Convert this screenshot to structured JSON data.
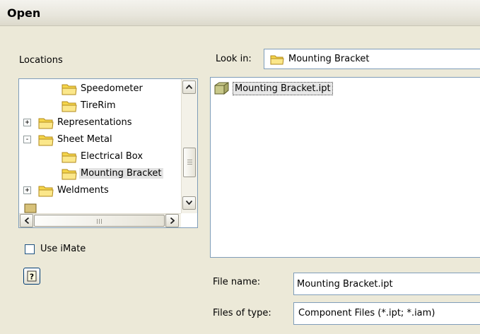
{
  "window": {
    "title": "Open"
  },
  "locations": {
    "label": "Locations",
    "items": [
      {
        "label": "Speedometer",
        "level": 2,
        "expander": "",
        "selected": false
      },
      {
        "label": "TireRim",
        "level": 2,
        "expander": "",
        "selected": false
      },
      {
        "label": "Representations",
        "level": 1,
        "expander": "+",
        "selected": false
      },
      {
        "label": "Sheet Metal",
        "level": 1,
        "expander": "−",
        "selected": false
      },
      {
        "label": "Electrical Box",
        "level": 2,
        "expander": "",
        "selected": false
      },
      {
        "label": "Mounting Bracket",
        "level": 2,
        "expander": "",
        "selected": true
      },
      {
        "label": "Weldments",
        "level": 1,
        "expander": "+",
        "selected": false
      }
    ]
  },
  "look_in": {
    "label": "Look in:",
    "value": "Mounting Bracket"
  },
  "files": [
    {
      "name": "Mounting Bracket.ipt"
    }
  ],
  "use_imate": {
    "label": "Use iMate",
    "checked": false
  },
  "help": {
    "glyph": "?"
  },
  "file_name": {
    "label": "File name:",
    "value": "Mounting Bracket.ipt"
  },
  "file_type": {
    "label": "Files of type:",
    "value": "Component Files (*.ipt; *.iam)"
  },
  "colors": {
    "folder": "#f5d54a",
    "folder_edge": "#b28a1c",
    "part_icon": "#c9c98a",
    "border": "#7f9db9"
  },
  "icons": {
    "folder": "folder-icon",
    "part": "part-file-icon"
  }
}
